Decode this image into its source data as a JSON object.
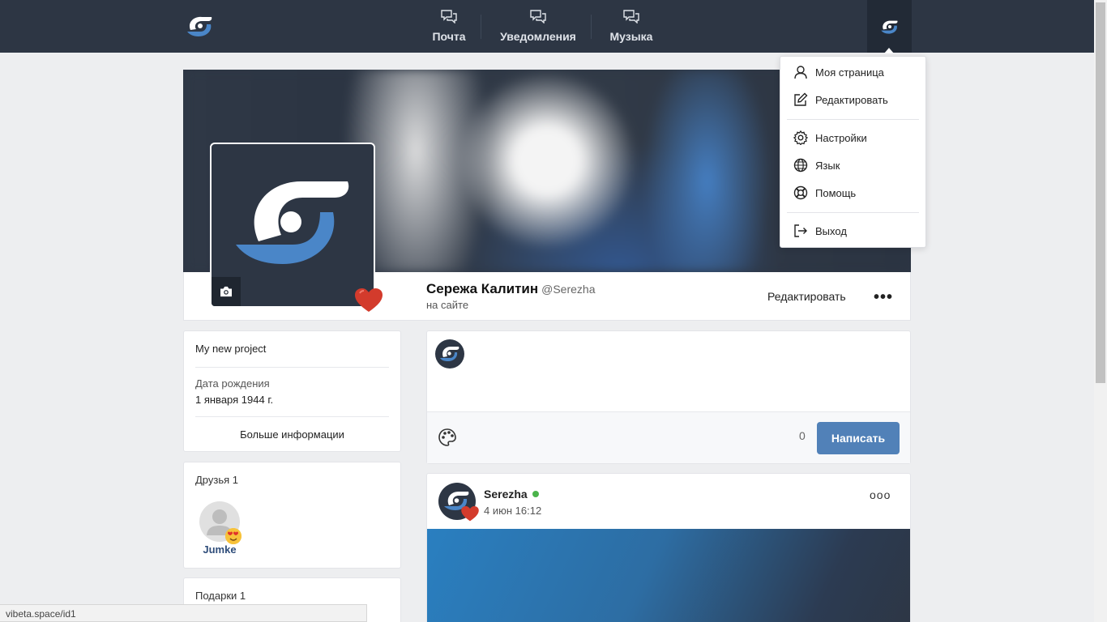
{
  "nav": {
    "mail": "Почта",
    "notifications": "Уведомления",
    "music": "Музыка"
  },
  "profile": {
    "name": "Сережа Калитин",
    "handle": "@Serezha",
    "status": "на сайте",
    "edit": "Редактировать",
    "more": "•••"
  },
  "info": {
    "project": "My new project",
    "birthday_label": "Дата рождения",
    "birthday_value": "1 января 1944 г.",
    "more_info": "Больше информации"
  },
  "friends": {
    "title": "Друзья 1",
    "items": [
      {
        "name": "Jumke"
      }
    ]
  },
  "gifts": {
    "title": "Подарки 1"
  },
  "composer": {
    "counter": "0",
    "submit": "Написать"
  },
  "post": {
    "author": "Serezha",
    "date": "4 июн 16:12",
    "more": "ooo"
  },
  "menu": {
    "my_page": "Моя страница",
    "edit": "Редактировать",
    "settings": "Настройки",
    "language": "Язык",
    "help": "Помощь",
    "logout": "Выход"
  },
  "statusbar": {
    "url": "vibeta.space/id1"
  },
  "colors": {
    "topbar": "#2d3644",
    "accent": "#5181b8",
    "logo_blue": "#4a86c8",
    "online": "#4bb34b",
    "heart": "#d33b2c"
  },
  "icons": [
    "logo-icon",
    "chat-icon",
    "camera-icon",
    "heart-icon",
    "palette-icon",
    "user-icon",
    "edit-icon",
    "gear-icon",
    "globe-icon",
    "lifebuoy-icon",
    "logout-icon"
  ]
}
